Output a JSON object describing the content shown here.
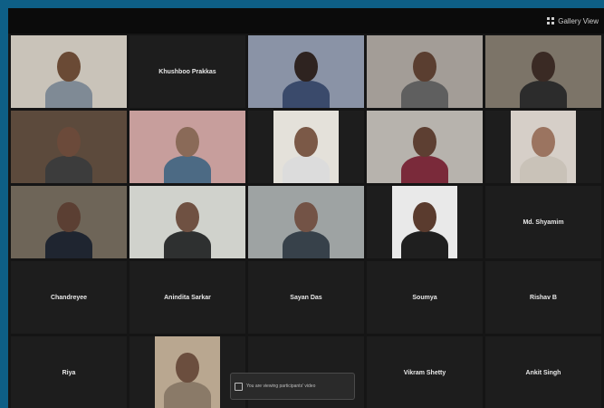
{
  "toolbar": {
    "view_label": "Gallery View"
  },
  "tiles": [
    {
      "type": "video",
      "bg": "#c9c3b9",
      "skin": "#6a4a35",
      "shirt": "#7f8a95"
    },
    {
      "type": "name",
      "label": "Khushboo Prakkas"
    },
    {
      "type": "video",
      "bg": "#8a93a6",
      "skin": "#2e2320",
      "shirt": "#3a4a6b"
    },
    {
      "type": "video",
      "bg": "#a39d97",
      "skin": "#5a3e30",
      "shirt": "#5f5f5f"
    },
    {
      "type": "video",
      "bg": "#7c7468",
      "skin": "#3a2a24",
      "shirt": "#2c2c2c"
    },
    {
      "type": "video",
      "bg": "#5c4a3c",
      "skin": "#6b4a3a",
      "shirt": "#3c3c3c"
    },
    {
      "type": "video",
      "bg": "#c79e9c",
      "skin": "#8a6a58",
      "shirt": "#4c6a84"
    },
    {
      "type": "video",
      "bg": "#e4e1da",
      "skin": "#7b5947",
      "shirt": "#dcdcdc",
      "inset": true
    },
    {
      "type": "video",
      "bg": "#b7b3ad",
      "skin": "#5d3f32",
      "shirt": "#7a2a3a"
    },
    {
      "type": "video",
      "bg": "#d6cfc8",
      "skin": "#9b7460",
      "shirt": "#c9c2b8",
      "inset": true
    },
    {
      "type": "video",
      "bg": "#6e6558",
      "skin": "#5b3f33",
      "shirt": "#1f2530"
    },
    {
      "type": "video",
      "bg": "#d0d2cc",
      "skin": "#6f5142",
      "shirt": "#2e3030"
    },
    {
      "type": "video",
      "bg": "#9ea3a3",
      "skin": "#735346",
      "shirt": "#37414a"
    },
    {
      "type": "video",
      "bg": "#e9e9e9",
      "skin": "#5a3b2e",
      "shirt": "#1f1f1f",
      "inset": true
    },
    {
      "type": "name",
      "label": "Md. Shyamim"
    },
    {
      "type": "name",
      "label": "Chandreyee"
    },
    {
      "type": "name",
      "label": "Anindita Sarkar"
    },
    {
      "type": "name",
      "label": "Sayan Das"
    },
    {
      "type": "name",
      "label": "Soumya"
    },
    {
      "type": "name",
      "label": "Rishav B"
    },
    {
      "type": "name",
      "label": "Riya"
    },
    {
      "type": "video",
      "bg": "#b9a790",
      "skin": "#6b4e3e",
      "shirt": "#8a7a68",
      "inset": true
    },
    {
      "type": "name",
      "label": ""
    },
    {
      "type": "name",
      "label": "Vikram Shetty"
    },
    {
      "type": "name",
      "label": "Ankit Singh"
    }
  ],
  "notification": {
    "text": "You are viewing participants' video"
  }
}
